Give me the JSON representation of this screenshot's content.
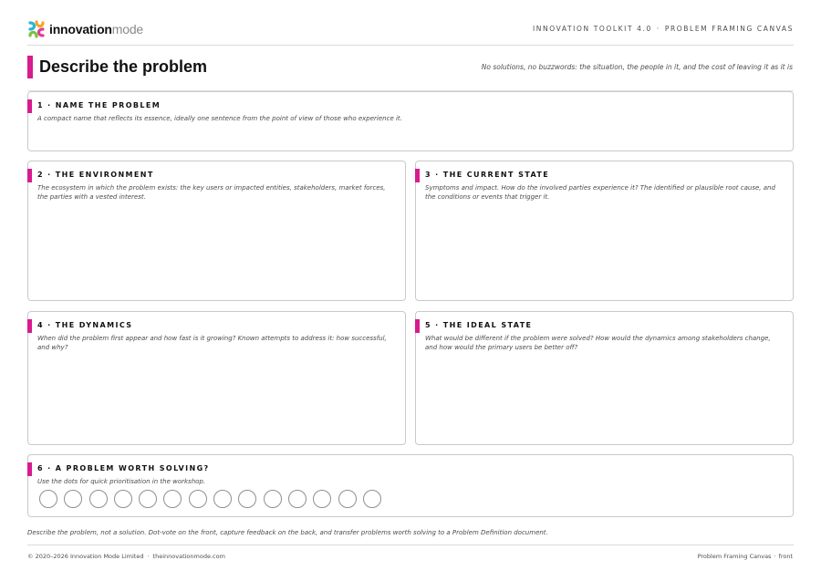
{
  "header": {
    "logo_bold": "innovation",
    "logo_light": "mode",
    "toolkit": "INNOVATION TOOLKIT 4.0",
    "separator": "·",
    "canvas_name": "PROBLEM FRAMING CANVAS"
  },
  "title": {
    "text": "Describe the problem",
    "note": "No solutions, no buzzwords: the situation, the people in it, and the cost of leaving it as it is"
  },
  "sections": [
    {
      "heading": "1 · NAME THE PROBLEM",
      "description": "A compact name that reflects its essence, ideally one sentence from the point of view of those who experience it."
    },
    {
      "heading": "2 · THE ENVIRONMENT",
      "description": "The ecosystem in which the problem exists: the key users or impacted entities, stakeholders, market forces, the parties with a vested interest."
    },
    {
      "heading": "3 · THE CURRENT STATE",
      "description": "Symptoms and impact. How do the involved parties experience it? The identified or plausible root cause, and the conditions or events that trigger it."
    },
    {
      "heading": "4 · THE DYNAMICS",
      "description": "When did the problem first appear and how fast is it growing? Known attempts to address it: how successful, and why?"
    },
    {
      "heading": "5 · THE IDEAL STATE",
      "description": "What would be different if the problem were solved? How would the dynamics among stakeholders change, and how would the primary users be better off?"
    },
    {
      "heading": "6 · A PROBLEM WORTH SOLVING?",
      "description": "Use the dots for quick prioritisation in the workshop."
    }
  ],
  "vote_dots": 14,
  "footer": {
    "note": "Describe the problem, not a solution. Dot-vote on the front, capture feedback on the back, and transfer problems worth solving to a Problem Definition document.",
    "copyright": "© 2020–2026 Innovation Mode Limited",
    "separator": "·",
    "website": "theinnovationmode.com",
    "page_label": "Problem Framing Canvas",
    "page_side": "front"
  },
  "colors": {
    "accent": "#d81b8f",
    "border": "#c9c9c9",
    "logo_cyan": "#2bb3d8",
    "logo_orange": "#f5a623",
    "logo_pink": "#e23d8f",
    "logo_green": "#7cc242"
  }
}
